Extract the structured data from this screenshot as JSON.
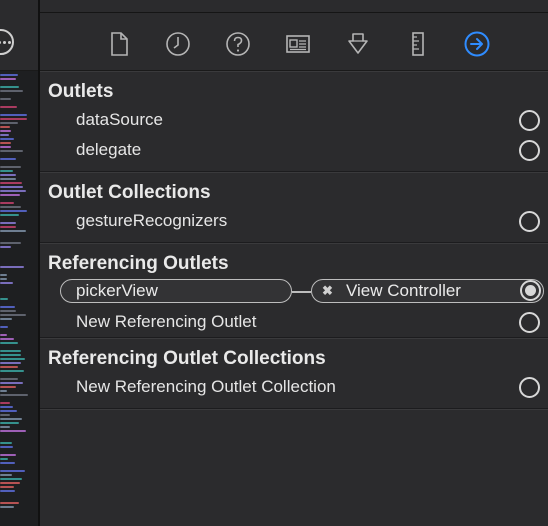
{
  "toolbar": {
    "icons": [
      "file-inspector-icon",
      "history-inspector-icon",
      "quick-help-icon",
      "identity-inspector-icon",
      "attributes-inspector-icon",
      "size-inspector-icon",
      "connections-inspector-icon"
    ],
    "active_color": "#2f8cff",
    "icon_color": "#b5b5b5"
  },
  "sections": {
    "outlets": {
      "title": "Outlets",
      "items": [
        "dataSource",
        "delegate"
      ]
    },
    "outlet_collections": {
      "title": "Outlet Collections",
      "items": [
        "gestureRecognizers"
      ]
    },
    "referencing_outlets": {
      "title": "Referencing Outlets",
      "connection": {
        "outlet": "pickerView",
        "target_mark": "✖",
        "target": "View Controller"
      },
      "new_item": "New Referencing Outlet"
    },
    "referencing_outlet_collections": {
      "title": "Referencing Outlet Collections",
      "new_item": "New Referencing Outlet Collection"
    }
  }
}
